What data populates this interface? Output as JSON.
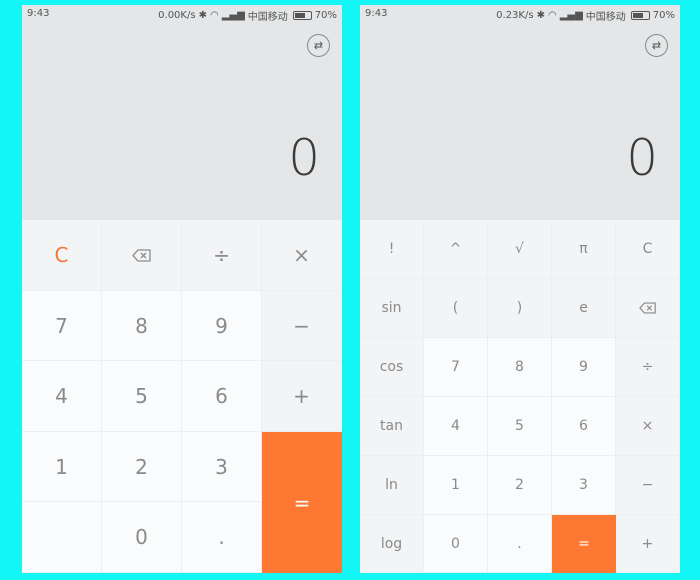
{
  "left_screen": {
    "status": {
      "time": "9:43",
      "speed": "0.00K/s",
      "carrier": "中国移动",
      "battery": "70%",
      "battery_level": 0.7
    },
    "display_value": "0",
    "keys": {
      "clear": "C",
      "divide": "÷",
      "multiply": "×",
      "seven": "7",
      "eight": "8",
      "nine": "9",
      "minus": "−",
      "four": "4",
      "five": "5",
      "six": "6",
      "plus": "+",
      "one": "1",
      "two": "2",
      "three": "3",
      "zero": "0",
      "dot": ".",
      "equals": "="
    }
  },
  "right_screen": {
    "status": {
      "time": "9:43",
      "speed": "0.23K/s",
      "carrier": "中国移动",
      "battery": "70%",
      "battery_level": 0.7
    },
    "display_value": "0",
    "keys": {
      "factorial": "!",
      "power": "^",
      "sqrt": "√",
      "pi": "π",
      "clear": "C",
      "sin": "sin",
      "lparen": "(",
      "rparen": ")",
      "e": "e",
      "cos": "cos",
      "seven": "7",
      "eight": "8",
      "nine": "9",
      "divide": "÷",
      "tan": "tan",
      "four": "4",
      "five": "5",
      "six": "6",
      "multiply": "×",
      "ln": "ln",
      "one": "1",
      "two": "2",
      "three": "3",
      "minus": "−",
      "log": "log",
      "zero": "0",
      "dot": ".",
      "equals": "=",
      "plus": "+"
    }
  },
  "colors": {
    "accent": "#fd7833",
    "background": "#14f5f6",
    "display_bg": "#e4e6e8"
  },
  "icons": {
    "swap": "swap-icon",
    "backspace": "backspace-icon",
    "bluetooth": "bluetooth-icon",
    "wifi": "wifi-icon",
    "signal": "signal-icon",
    "battery": "battery-icon"
  }
}
